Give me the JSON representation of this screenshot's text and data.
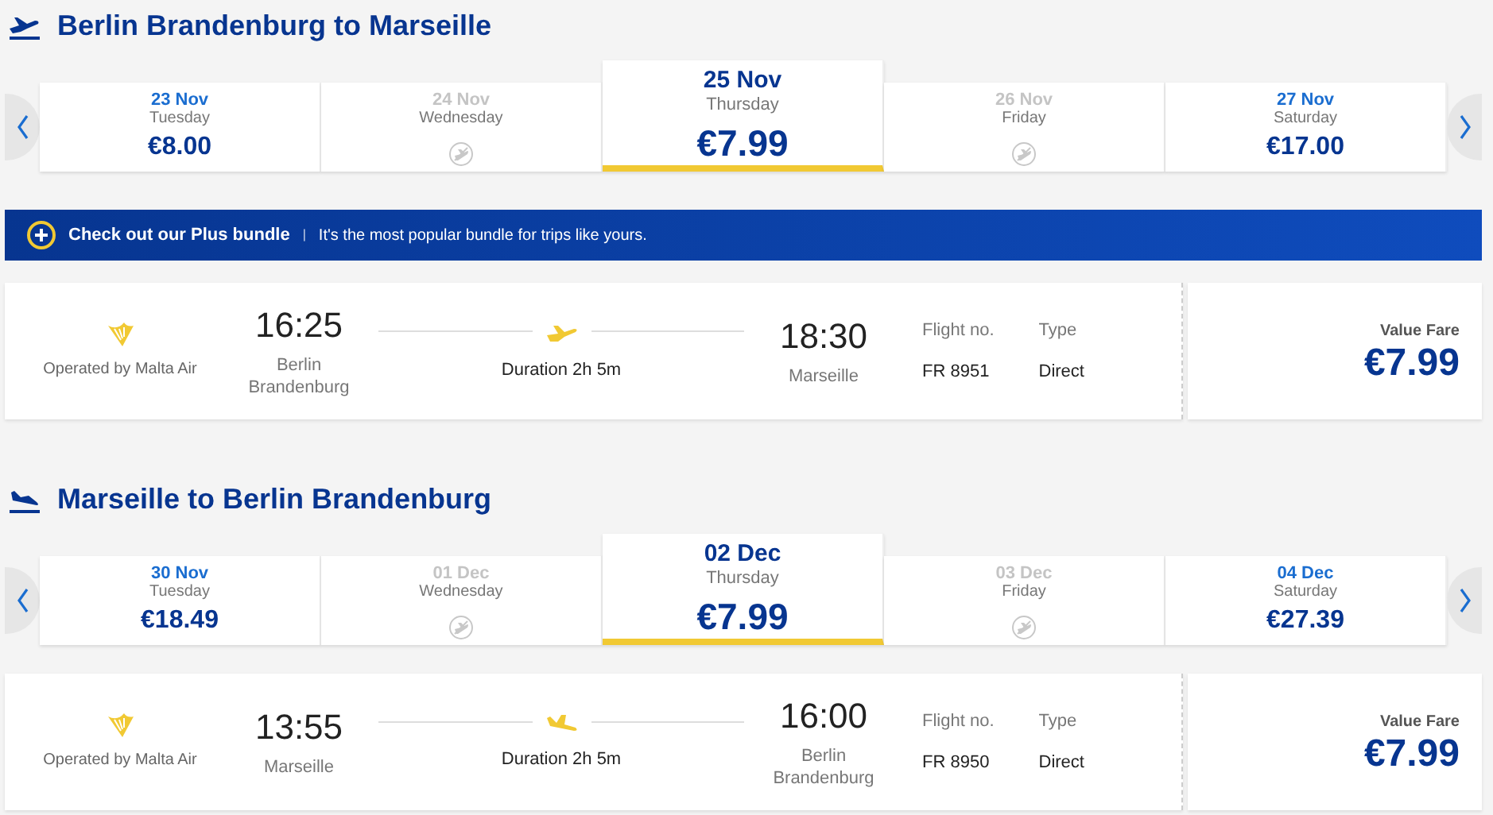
{
  "sections": [
    {
      "kind": "outbound",
      "title": "Berlin Brandenburg to Marseille",
      "dates": [
        {
          "kind": "fare",
          "date": "23 Nov",
          "day": "Tuesday",
          "price": "€8.00",
          "selected": false
        },
        {
          "kind": "no_flight",
          "date": "24 Nov",
          "day": "Wednesday",
          "selected": false
        },
        {
          "kind": "fare",
          "date": "25 Nov",
          "day": "Thursday",
          "price": "€7.99",
          "selected": true
        },
        {
          "kind": "no_flight",
          "date": "26 Nov",
          "day": "Friday",
          "selected": false
        },
        {
          "kind": "fare",
          "date": "27 Nov",
          "day": "Saturday",
          "price": "€17.00",
          "selected": false
        }
      ],
      "banner": {
        "title": "Check out our Plus bundle",
        "separator": "|",
        "text": "It's the most popular bundle for trips like yours."
      },
      "flight": {
        "operator": "Operated by Malta Air",
        "depart_time": "16:25",
        "depart_city": "Berlin Brandenburg",
        "duration": "Duration 2h 5m",
        "arrive_time": "18:30",
        "arrive_city": "Marseille",
        "flight_no_label": "Flight no.",
        "flight_no": "FR 8951",
        "type_label": "Type",
        "type": "Direct",
        "fare_name": "Value Fare",
        "fare_price": "€7.99"
      }
    },
    {
      "kind": "inbound",
      "title": "Marseille to Berlin Brandenburg",
      "dates": [
        {
          "kind": "fare",
          "date": "30 Nov",
          "day": "Tuesday",
          "price": "€18.49",
          "selected": false
        },
        {
          "kind": "no_flight",
          "date": "01 Dec",
          "day": "Wednesday",
          "selected": false
        },
        {
          "kind": "fare",
          "date": "02 Dec",
          "day": "Thursday",
          "price": "€7.99",
          "selected": true
        },
        {
          "kind": "no_flight",
          "date": "03 Dec",
          "day": "Friday",
          "selected": false
        },
        {
          "kind": "fare",
          "date": "04 Dec",
          "day": "Saturday",
          "price": "€27.39",
          "selected": false
        }
      ],
      "flight": {
        "operator": "Operated by Malta Air",
        "depart_time": "13:55",
        "depart_city": "Marseille",
        "duration": "Duration 2h 5m",
        "arrive_time": "16:00",
        "arrive_city": "Berlin Brandenburg",
        "flight_no_label": "Flight no.",
        "flight_no": "FR 8950",
        "type_label": "Type",
        "type": "Direct",
        "fare_name": "Value Fare",
        "fare_price": "€7.99"
      }
    }
  ]
}
